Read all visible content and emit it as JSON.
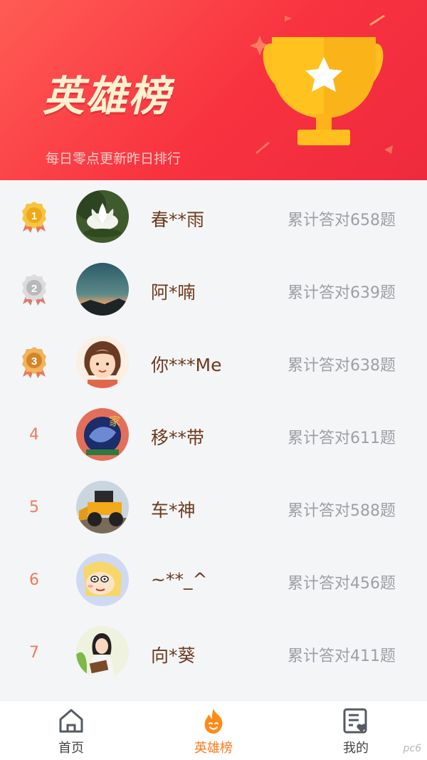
{
  "header": {
    "title": "英雄榜",
    "subtitle": "每日零点更新昨日排行",
    "trophy_icon": "trophy-star-icon"
  },
  "leaderboard": [
    {
      "rank": "1",
      "medal": "gold",
      "name": "春**雨",
      "score": "累计答对658题",
      "avatar": "lotus"
    },
    {
      "rank": "2",
      "medal": "silver",
      "name": "阿*喃",
      "score": "累计答对639题",
      "avatar": "sunset"
    },
    {
      "rank": "3",
      "medal": "bronze",
      "name": "你***Me",
      "score": "累计答对638题",
      "avatar": "cartoon-girl"
    },
    {
      "rank": "4",
      "medal": "",
      "name": "移**带",
      "score": "累计答对611题",
      "avatar": "calligraphy"
    },
    {
      "rank": "5",
      "medal": "",
      "name": "车*神",
      "score": "累计答对588题",
      "avatar": "loader"
    },
    {
      "rank": "6",
      "medal": "",
      "name": "~**_^",
      "score": "累计答对456题",
      "avatar": "crayon-boy"
    },
    {
      "rank": "7",
      "medal": "",
      "name": "向*葵",
      "score": "累计答对411题",
      "avatar": "reading-girl"
    }
  ],
  "tabbar": {
    "items": [
      {
        "label": "首页",
        "icon": "home-icon",
        "active": false
      },
      {
        "label": "英雄榜",
        "icon": "flame-icon",
        "active": true
      },
      {
        "label": "我的",
        "icon": "profile-card-icon",
        "active": false
      }
    ]
  },
  "watermark": "pc6",
  "colors": {
    "header_red": "#f8323f",
    "title_cream": "#fff2d0",
    "name_brown": "#6d3a1d",
    "rank_orange": "#f07a5a",
    "active_tab": "#ff7a1a"
  }
}
